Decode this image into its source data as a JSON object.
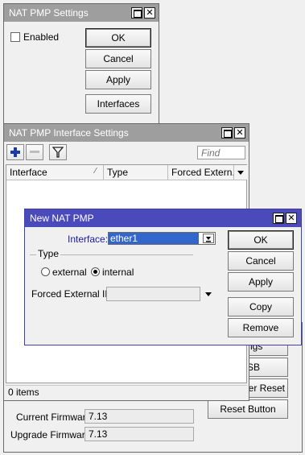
{
  "bg_window": {
    "title": "NAT PMP Settings",
    "enabled_label": "Enabled",
    "buttons": [
      "OK",
      "Cancel",
      "Apply",
      "Interfaces"
    ],
    "partial_buttons": [
      "ngs",
      "SB",
      "ier Reset",
      "Reset Button"
    ],
    "current_firmware_label": "Current Firmware:",
    "current_firmware_value": "7.13",
    "upgrade_firmware_label": "Upgrade Firmware:",
    "upgrade_firmware_value": "7.13"
  },
  "iface_window": {
    "title": "NAT PMP Interface Settings",
    "find_placeholder": "Find",
    "columns": [
      "Interface",
      "Type",
      "Forced Extern..."
    ],
    "status": "0 items"
  },
  "new_window": {
    "title": "New NAT PMP",
    "interface_label": "Interface:",
    "interface_value": "ether1",
    "type_group_label": "Type",
    "type_options": [
      "external",
      "internal"
    ],
    "type_selected": "internal",
    "forced_ip_label": "Forced External IP:",
    "forced_ip_value": "",
    "buttons": [
      "OK",
      "Cancel",
      "Apply",
      "Copy",
      "Remove"
    ]
  },
  "colors": {
    "active_title": "#4a4aba",
    "inactive_title": "#9e9e9e",
    "selection": "#3366cc",
    "label_blue": "#1a1aa6"
  }
}
